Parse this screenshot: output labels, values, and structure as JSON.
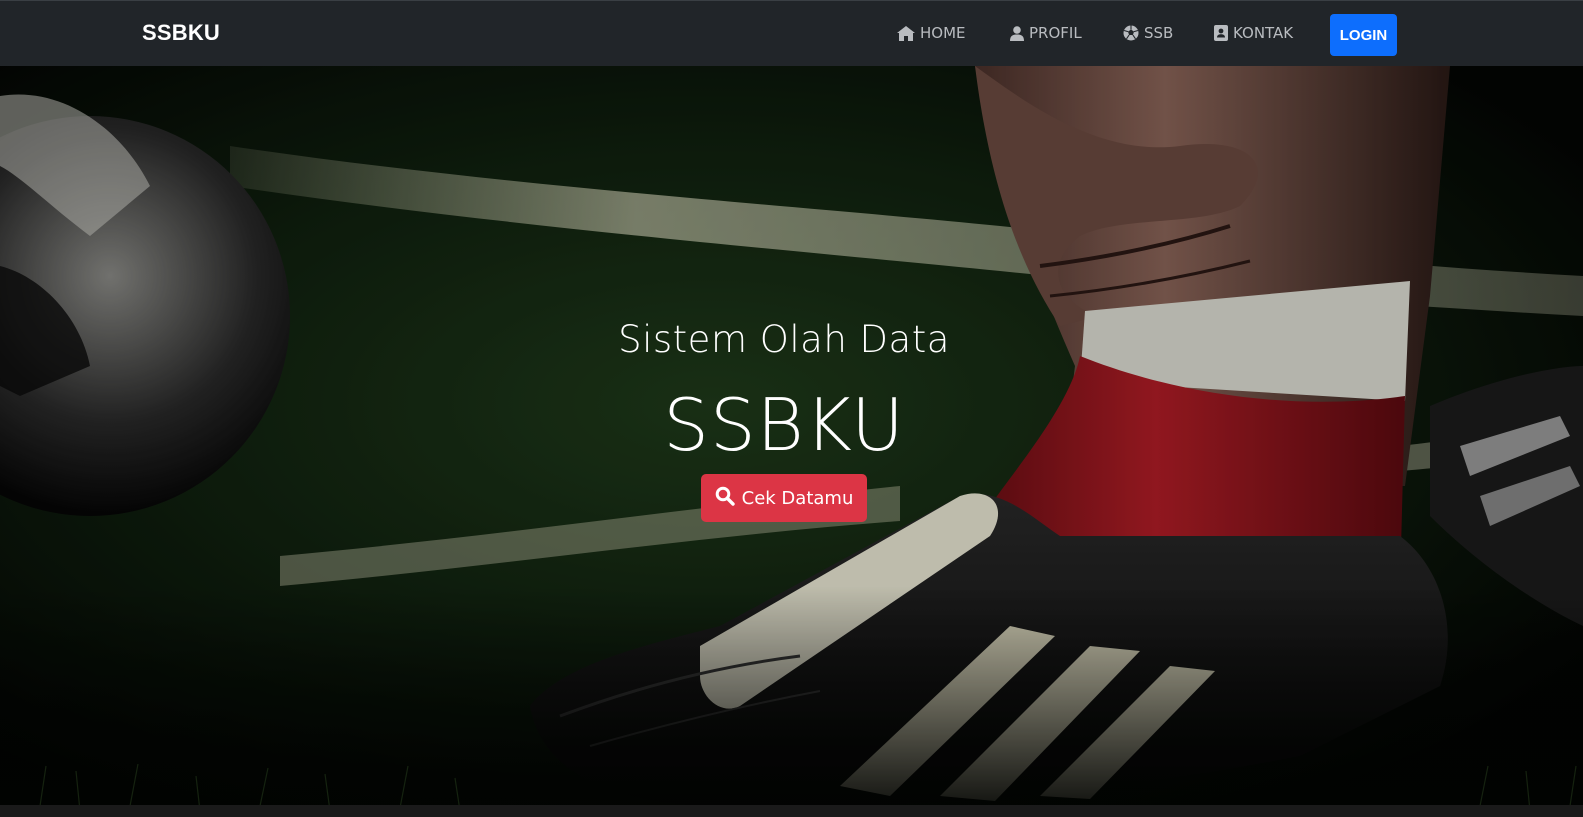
{
  "navbar": {
    "brand": "SSBKU",
    "items": [
      {
        "label": "HOME",
        "icon": "home-icon"
      },
      {
        "label": "PROFIL",
        "icon": "user-icon"
      },
      {
        "label": "SSB",
        "icon": "soccer-ball-icon"
      },
      {
        "label": "KONTAK",
        "icon": "contact-card-icon"
      }
    ],
    "login_label": "LOGIN"
  },
  "hero": {
    "subtitle": "Sistem Olah Data",
    "title": "SSBKU",
    "button_label": "Cek Datamu",
    "button_icon": "search-icon",
    "background": "football-boot-photo"
  },
  "colors": {
    "navbar_bg": "#212529",
    "login_btn": "#0d6efd",
    "cta_btn": "#dc3545",
    "nav_text": "#b9bcc0"
  }
}
